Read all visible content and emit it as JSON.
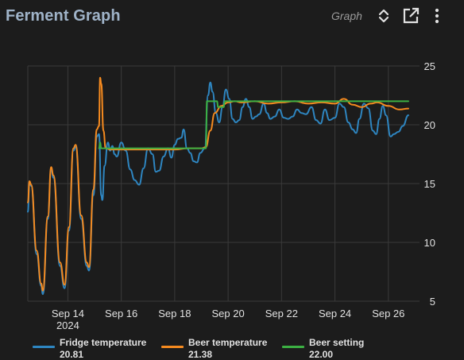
{
  "header": {
    "title": "Ferment Graph",
    "view_label": "Graph",
    "icons": [
      "sort-icon",
      "open-in-new-icon",
      "more-vert-icon"
    ]
  },
  "colors": {
    "fridge": "#2e86c1",
    "beer": "#f58a1f",
    "setting": "#3cb043",
    "grid": "#3a3a3a",
    "axis_text": "#e1e1e1"
  },
  "legend": [
    {
      "name": "Fridge temperature",
      "value": "20.81",
      "color_key": "fridge"
    },
    {
      "name": "Beer temperature",
      "value": "21.38",
      "color_key": "beer"
    },
    {
      "name": "Beer setting",
      "value": "22.00",
      "color_key": "setting"
    }
  ],
  "chart_data": {
    "type": "line",
    "title": "",
    "xlabel": "",
    "ylabel": "",
    "ylim": [
      5,
      25
    ],
    "yticks": [
      5,
      10,
      15,
      20,
      25
    ],
    "xlim": [
      "2024-09-12T12:00",
      "2024-09-26T18:00"
    ],
    "xticks": [
      {
        "x": "2024-09-14",
        "label": "Sep 14",
        "sublabel": "2024"
      },
      {
        "x": "2024-09-16",
        "label": "Sep 16"
      },
      {
        "x": "2024-09-18",
        "label": "Sep 18"
      },
      {
        "x": "2024-09-20",
        "label": "Sep 20"
      },
      {
        "x": "2024-09-22",
        "label": "Sep 22"
      },
      {
        "x": "2024-09-24",
        "label": "Sep 24"
      },
      {
        "x": "2024-09-26",
        "label": "Sep 26"
      }
    ],
    "grid": true,
    "legend_position": "bottom",
    "series": [
      {
        "name": "Fridge temperature",
        "color_key": "fridge",
        "points": [
          [
            "2024-09-12T12:00",
            12.6
          ],
          [
            "2024-09-12T13:30",
            15.1
          ],
          [
            "2024-09-12T15:00",
            14.8
          ],
          [
            "2024-09-12T20:00",
            9.0
          ],
          [
            "2024-09-13T00:00",
            6.3
          ],
          [
            "2024-09-13T01:30",
            5.6
          ],
          [
            "2024-09-13T06:00",
            12.0
          ],
          [
            "2024-09-13T09:00",
            16.2
          ],
          [
            "2024-09-13T11:00",
            15.5
          ],
          [
            "2024-09-13T17:00",
            8.0
          ],
          [
            "2024-09-13T21:00",
            6.1
          ],
          [
            "2024-09-14T01:00",
            11.0
          ],
          [
            "2024-09-14T05:00",
            17.8
          ],
          [
            "2024-09-14T07:00",
            18.1
          ],
          [
            "2024-09-14T12:00",
            12.0
          ],
          [
            "2024-09-14T17:00",
            8.0
          ],
          [
            "2024-09-14T19:00",
            7.6
          ],
          [
            "2024-09-14T23:00",
            14.0
          ],
          [
            "2024-09-15T02:00",
            19.0
          ],
          [
            "2024-09-15T04:00",
            19.2
          ],
          [
            "2024-09-15T06:00",
            14.0
          ],
          [
            "2024-09-15T07:00",
            13.6
          ],
          [
            "2024-09-15T09:00",
            16.5
          ],
          [
            "2024-09-15T12:00",
            18.5
          ],
          [
            "2024-09-15T14:00",
            17.8
          ],
          [
            "2024-09-15T16:00",
            18.2
          ],
          [
            "2024-09-15T18:00",
            17.5
          ],
          [
            "2024-09-15T20:00",
            17.3
          ],
          [
            "2024-09-16T00:00",
            18.5
          ],
          [
            "2024-09-16T04:00",
            17.8
          ],
          [
            "2024-09-16T08:00",
            16.2
          ],
          [
            "2024-09-16T12:00",
            15.3
          ],
          [
            "2024-09-16T16:00",
            14.9
          ],
          [
            "2024-09-16T20:00",
            16.3
          ],
          [
            "2024-09-17T00:00",
            18.0
          ],
          [
            "2024-09-17T04:00",
            17.5
          ],
          [
            "2024-09-17T07:00",
            16.0
          ],
          [
            "2024-09-17T10:00",
            16.1
          ],
          [
            "2024-09-17T14:00",
            17.3
          ],
          [
            "2024-09-17T18:00",
            18.0
          ],
          [
            "2024-09-17T21:00",
            17.2
          ],
          [
            "2024-09-18T00:00",
            18.3
          ],
          [
            "2024-09-18T03:00",
            18.8
          ],
          [
            "2024-09-18T06:00",
            18.9
          ],
          [
            "2024-09-18T08:00",
            19.6
          ],
          [
            "2024-09-18T11:00",
            18.0
          ],
          [
            "2024-09-18T14:00",
            17.6
          ],
          [
            "2024-09-18T17:00",
            16.9
          ],
          [
            "2024-09-18T20:00",
            16.8
          ],
          [
            "2024-09-18T23:00",
            17.6
          ],
          [
            "2024-09-19T03:00",
            18.0
          ],
          [
            "2024-09-19T06:00",
            22.5
          ],
          [
            "2024-09-19T08:00",
            23.6
          ],
          [
            "2024-09-19T10:00",
            22.8
          ],
          [
            "2024-09-19T13:00",
            21.0
          ],
          [
            "2024-09-19T16:00",
            20.2
          ],
          [
            "2024-09-19T19:00",
            21.5
          ],
          [
            "2024-09-19T22:00",
            23.0
          ],
          [
            "2024-09-20T01:00",
            22.2
          ],
          [
            "2024-09-20T04:00",
            20.5
          ],
          [
            "2024-09-20T07:00",
            20.2
          ],
          [
            "2024-09-20T10:00",
            20.4
          ],
          [
            "2024-09-20T13:00",
            21.5
          ],
          [
            "2024-09-20T16:00",
            22.2
          ],
          [
            "2024-09-20T19:00",
            21.5
          ],
          [
            "2024-09-20T22:00",
            20.5
          ],
          [
            "2024-09-21T01:00",
            20.7
          ],
          [
            "2024-09-21T04:00",
            20.9
          ],
          [
            "2024-09-21T08:00",
            21.8
          ],
          [
            "2024-09-21T11:00",
            21.0
          ],
          [
            "2024-09-21T14:00",
            20.5
          ],
          [
            "2024-09-21T18:00",
            20.7
          ],
          [
            "2024-09-21T22:00",
            21.3
          ],
          [
            "2024-09-22T02:00",
            20.6
          ],
          [
            "2024-09-22T06:00",
            20.5
          ],
          [
            "2024-09-22T10:00",
            20.7
          ],
          [
            "2024-09-22T14:00",
            21.3
          ],
          [
            "2024-09-22T18:00",
            21.0
          ],
          [
            "2024-09-22T22:00",
            20.9
          ],
          [
            "2024-09-23T03:00",
            21.5
          ],
          [
            "2024-09-23T07:00",
            20.4
          ],
          [
            "2024-09-23T11:00",
            20.1
          ],
          [
            "2024-09-23T15:00",
            21.3
          ],
          [
            "2024-09-23T19:00",
            20.4
          ],
          [
            "2024-09-24T00:00",
            20.6
          ],
          [
            "2024-09-24T04:00",
            21.8
          ],
          [
            "2024-09-24T08:00",
            21.5
          ],
          [
            "2024-09-24T12:00",
            20.2
          ],
          [
            "2024-09-24T16:00",
            19.6
          ],
          [
            "2024-09-24T19:00",
            19.3
          ],
          [
            "2024-09-24T22:00",
            20.5
          ],
          [
            "2024-09-25T02:00",
            21.8
          ],
          [
            "2024-09-25T06:00",
            21.4
          ],
          [
            "2024-09-25T10:00",
            19.5
          ],
          [
            "2024-09-25T13:00",
            19.2
          ],
          [
            "2024-09-25T16:00",
            20.5
          ],
          [
            "2024-09-25T19:00",
            21.6
          ],
          [
            "2024-09-25T22:00",
            20.8
          ],
          [
            "2024-09-26T02:00",
            19.0
          ],
          [
            "2024-09-26T05:00",
            19.2
          ],
          [
            "2024-09-26T09:00",
            19.4
          ],
          [
            "2024-09-26T13:00",
            19.9
          ],
          [
            "2024-09-26T18:00",
            20.81
          ]
        ]
      },
      {
        "name": "Beer temperature",
        "color_key": "beer",
        "points": [
          [
            "2024-09-12T12:00",
            13.4
          ],
          [
            "2024-09-12T13:30",
            15.2
          ],
          [
            "2024-09-12T15:00",
            14.9
          ],
          [
            "2024-09-12T20:00",
            9.3
          ],
          [
            "2024-09-13T00:00",
            6.5
          ],
          [
            "2024-09-13T01:30",
            5.9
          ],
          [
            "2024-09-13T06:00",
            12.2
          ],
          [
            "2024-09-13T09:00",
            16.4
          ],
          [
            "2024-09-13T11:00",
            15.7
          ],
          [
            "2024-09-13T17:00",
            8.3
          ],
          [
            "2024-09-13T21:00",
            6.4
          ],
          [
            "2024-09-14T01:00",
            11.3
          ],
          [
            "2024-09-14T05:00",
            18.0
          ],
          [
            "2024-09-14T07:00",
            18.3
          ],
          [
            "2024-09-14T12:00",
            12.3
          ],
          [
            "2024-09-14T17:00",
            8.3
          ],
          [
            "2024-09-14T19:00",
            7.9
          ],
          [
            "2024-09-14T23:00",
            14.5
          ],
          [
            "2024-09-15T02:00",
            19.6
          ],
          [
            "2024-09-15T04:00",
            19.9
          ],
          [
            "2024-09-15T05:00",
            24.0
          ],
          [
            "2024-09-15T06:00",
            23.5
          ],
          [
            "2024-09-15T08:00",
            19.5
          ],
          [
            "2024-09-15T10:00",
            18.0
          ],
          [
            "2024-09-15T14:00",
            17.9
          ],
          [
            "2024-09-16T00:00",
            17.9
          ],
          [
            "2024-09-16T12:00",
            17.9
          ],
          [
            "2024-09-17T00:00",
            17.9
          ],
          [
            "2024-09-17T12:00",
            17.9
          ],
          [
            "2024-09-18T00:00",
            17.9
          ],
          [
            "2024-09-18T12:00",
            18.0
          ],
          [
            "2024-09-19T00:00",
            18.0
          ],
          [
            "2024-09-19T04:00",
            18.1
          ],
          [
            "2024-09-19T08:00",
            19.5
          ],
          [
            "2024-09-19T12:00",
            21.0
          ],
          [
            "2024-09-19T18:00",
            21.6
          ],
          [
            "2024-09-20T00:00",
            21.9
          ],
          [
            "2024-09-20T06:00",
            22.0
          ],
          [
            "2024-09-20T12:00",
            21.9
          ],
          [
            "2024-09-21T00:00",
            22.0
          ],
          [
            "2024-09-21T12:00",
            21.8
          ],
          [
            "2024-09-22T00:00",
            21.9
          ],
          [
            "2024-09-22T12:00",
            22.0
          ],
          [
            "2024-09-23T00:00",
            21.8
          ],
          [
            "2024-09-23T12:00",
            21.9
          ],
          [
            "2024-09-24T00:00",
            21.8
          ],
          [
            "2024-09-24T08:00",
            22.2
          ],
          [
            "2024-09-24T16:00",
            21.7
          ],
          [
            "2024-09-25T00:00",
            21.5
          ],
          [
            "2024-09-25T08:00",
            21.8
          ],
          [
            "2024-09-25T14:00",
            21.9
          ],
          [
            "2024-09-26T00:00",
            21.6
          ],
          [
            "2024-09-26T10:00",
            21.3
          ],
          [
            "2024-09-26T18:00",
            21.38
          ]
        ]
      },
      {
        "name": "Beer setting",
        "color_key": "setting",
        "points": [
          [
            "2024-09-15T04:00",
            18.0
          ],
          [
            "2024-09-15T05:00",
            18.5
          ],
          [
            "2024-09-15T06:00",
            18.0
          ],
          [
            "2024-09-15T14:00",
            18.0
          ],
          [
            "2024-09-19T04:00",
            18.0
          ],
          [
            "2024-09-19T05:00",
            22.0
          ],
          [
            "2024-09-19T14:00",
            22.0
          ],
          [
            "2024-09-19T15:00",
            21.5
          ],
          [
            "2024-09-19T20:00",
            21.5
          ],
          [
            "2024-09-19T21:00",
            22.0
          ],
          [
            "2024-09-26T18:00",
            22.0
          ]
        ]
      }
    ]
  }
}
